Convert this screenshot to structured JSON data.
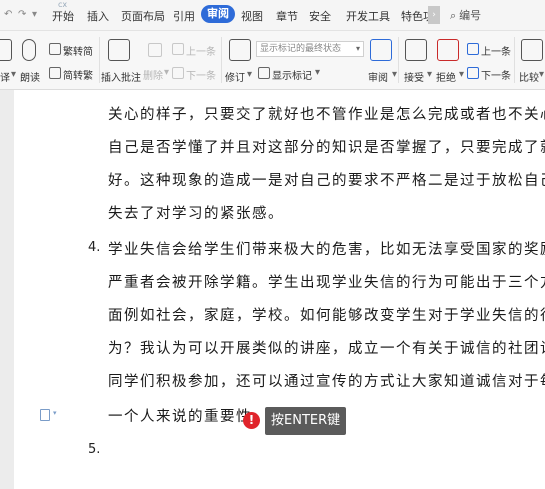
{
  "window": {
    "doc_tab_fragment": "cx"
  },
  "menu": {
    "tabs": [
      "开始",
      "插入",
      "页面布局",
      "引用",
      "审阅",
      "视图",
      "章节",
      "安全",
      "开发工具",
      "特色功"
    ],
    "active_tab": "审阅",
    "search_label": "编号"
  },
  "ribbon": {
    "convert_trad": "繁转简",
    "convert_simp": "简转繁",
    "read_aloud": "朗读",
    "translate_fragment": "译",
    "insert_comment": "插入批注",
    "delete": "删除",
    "prev_comment": "上一条",
    "next_comment": "下一条",
    "revise": "修订",
    "markup_select_placeholder": "显示标记的最终状态",
    "show_markup": "显示标记",
    "review": "审阅",
    "accept": "接受",
    "reject": "拒绝",
    "prev_change": "上一条",
    "next_change": "下一条",
    "compare": "比较"
  },
  "document": {
    "para3_lines": [
      "关心的样子，只要交了就好也不管作业是怎么完成或者也不关心",
      "自己是否学懂了并且对这部分的知识是否掌握了，只要完成了就",
      "好。这种现象的造成一是对自己的要求不严格二是过于放松自己",
      "失去了对学习的紧张感。"
    ],
    "item4_number": "4.",
    "item4_lines": [
      "学业失信会给学生们带来极大的危害，比如无法享受国家的奖励，",
      "严重者会被开除学籍。学生出现学业失信的行为可能出于三个方",
      "面例如社会，家庭，学校。如何能够改变学生对于学业失信的行",
      "为？我认为可以开展类似的讲座，成立一个有关于诚信的社团让",
      "同学们积极参加，还可以通过宣传的方式让大家知道诚信对于每",
      "一个人来说的重要性。"
    ],
    "item5_number": "5."
  },
  "tooltip": {
    "alert_glyph": "!",
    "text": "按ENTER键"
  }
}
